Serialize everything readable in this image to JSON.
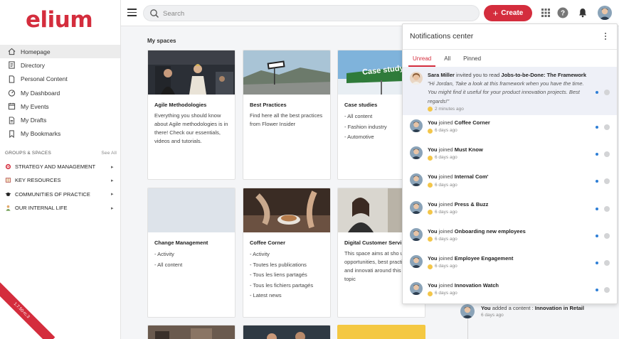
{
  "app": {
    "logo": "elium",
    "version": "1.7.50-rc.3"
  },
  "colors": {
    "brand": "#d42d3d",
    "unread_dot": "#2f7fd6"
  },
  "sidebar": {
    "items": [
      {
        "label": "Homepage",
        "icon": "home-icon",
        "active": true
      },
      {
        "label": "Directory",
        "icon": "directory-icon"
      },
      {
        "label": "Personal Content",
        "icon": "document-icon"
      },
      {
        "label": "My Dashboard",
        "icon": "dashboard-icon"
      },
      {
        "label": "My Events",
        "icon": "calendar-icon"
      },
      {
        "label": "My Drafts",
        "icon": "draft-icon"
      },
      {
        "label": "My Bookmarks",
        "icon": "bookmark-icon"
      }
    ],
    "groups_title": "GROUPS & SPACES",
    "see_all": "See All",
    "groups": [
      {
        "label": "STRATEGY AND MANAGEMENT",
        "icon": "target-icon"
      },
      {
        "label": "KEY RESOURCES",
        "icon": "book-icon"
      },
      {
        "label": "COMMUNITIES OF PRACTICE",
        "icon": "graduation-cap-icon"
      },
      {
        "label": "OUR INTERNAL LIFE",
        "icon": "person-icon"
      }
    ]
  },
  "topbar": {
    "search_placeholder": "Search",
    "create_label": "Create",
    "icons": [
      "apps-grid-icon",
      "help-icon",
      "bell-icon",
      "user-avatar"
    ]
  },
  "main": {
    "section_title": "My spaces",
    "cards": [
      {
        "title": "Agile Methodologies",
        "description": "Everything you should know about Agile methodologies is in there! Check our essentials, videos and tutorials."
      },
      {
        "title": "Best Practices",
        "description": "Find here all the best practices from Flower Insider"
      },
      {
        "title": "Case studies",
        "items": [
          "- All content",
          "- Fashion industry",
          "- Automotive"
        ],
        "image_text": "Case study"
      },
      {
        "title": "Change Management",
        "items": [
          "- Activity",
          "- All content"
        ]
      },
      {
        "title": "Coffee Corner",
        "items": [
          "- Activity",
          "- Toutes les publications",
          "- Tous les liens partagés",
          "- Tous les fichiers partagés",
          "- Latest news"
        ]
      },
      {
        "title": "Digital Customer Servi",
        "description": "This space aims at sho up opportunities, best practices and innovati around this huge topic"
      }
    ]
  },
  "notifications": {
    "title": "Notifications center",
    "tabs": [
      "Unread",
      "All",
      "Pinned"
    ],
    "active_tab": "Unread",
    "first": {
      "user": "Sara Miller",
      "action": " invited you to read ",
      "target": "Jobs-to-be-Done: The Framework",
      "message": "\"Hi Jordan, Take a look at this framework when you have the time. You might find it useful for your product innovation projects. Best regards!\"",
      "time": "2 minutes ago"
    },
    "items": [
      {
        "user": "You",
        "action": " joined ",
        "target": "Coffee Corner",
        "time": "6 days ago"
      },
      {
        "user": "You",
        "action": " joined ",
        "target": "Must Know",
        "time": "6 days ago"
      },
      {
        "user": "You",
        "action": " joined ",
        "target": "Internal Com'",
        "time": "6 days ago"
      },
      {
        "user": "You",
        "action": " joined ",
        "target": "Press & Buzz",
        "time": "6 days ago"
      },
      {
        "user": "You",
        "action": " joined ",
        "target": "Onboarding new employees",
        "time": "6 days ago"
      },
      {
        "user": "You",
        "action": " joined ",
        "target": "Employee Engagement",
        "time": "6 days ago"
      },
      {
        "user": "You",
        "action": " joined ",
        "target": "Innovation Watch",
        "time": "6 days ago"
      }
    ]
  },
  "activity": [
    {
      "user": "You",
      "action": " added a content : ",
      "target": "Innovation in Retail",
      "time": "6 days ago"
    }
  ]
}
